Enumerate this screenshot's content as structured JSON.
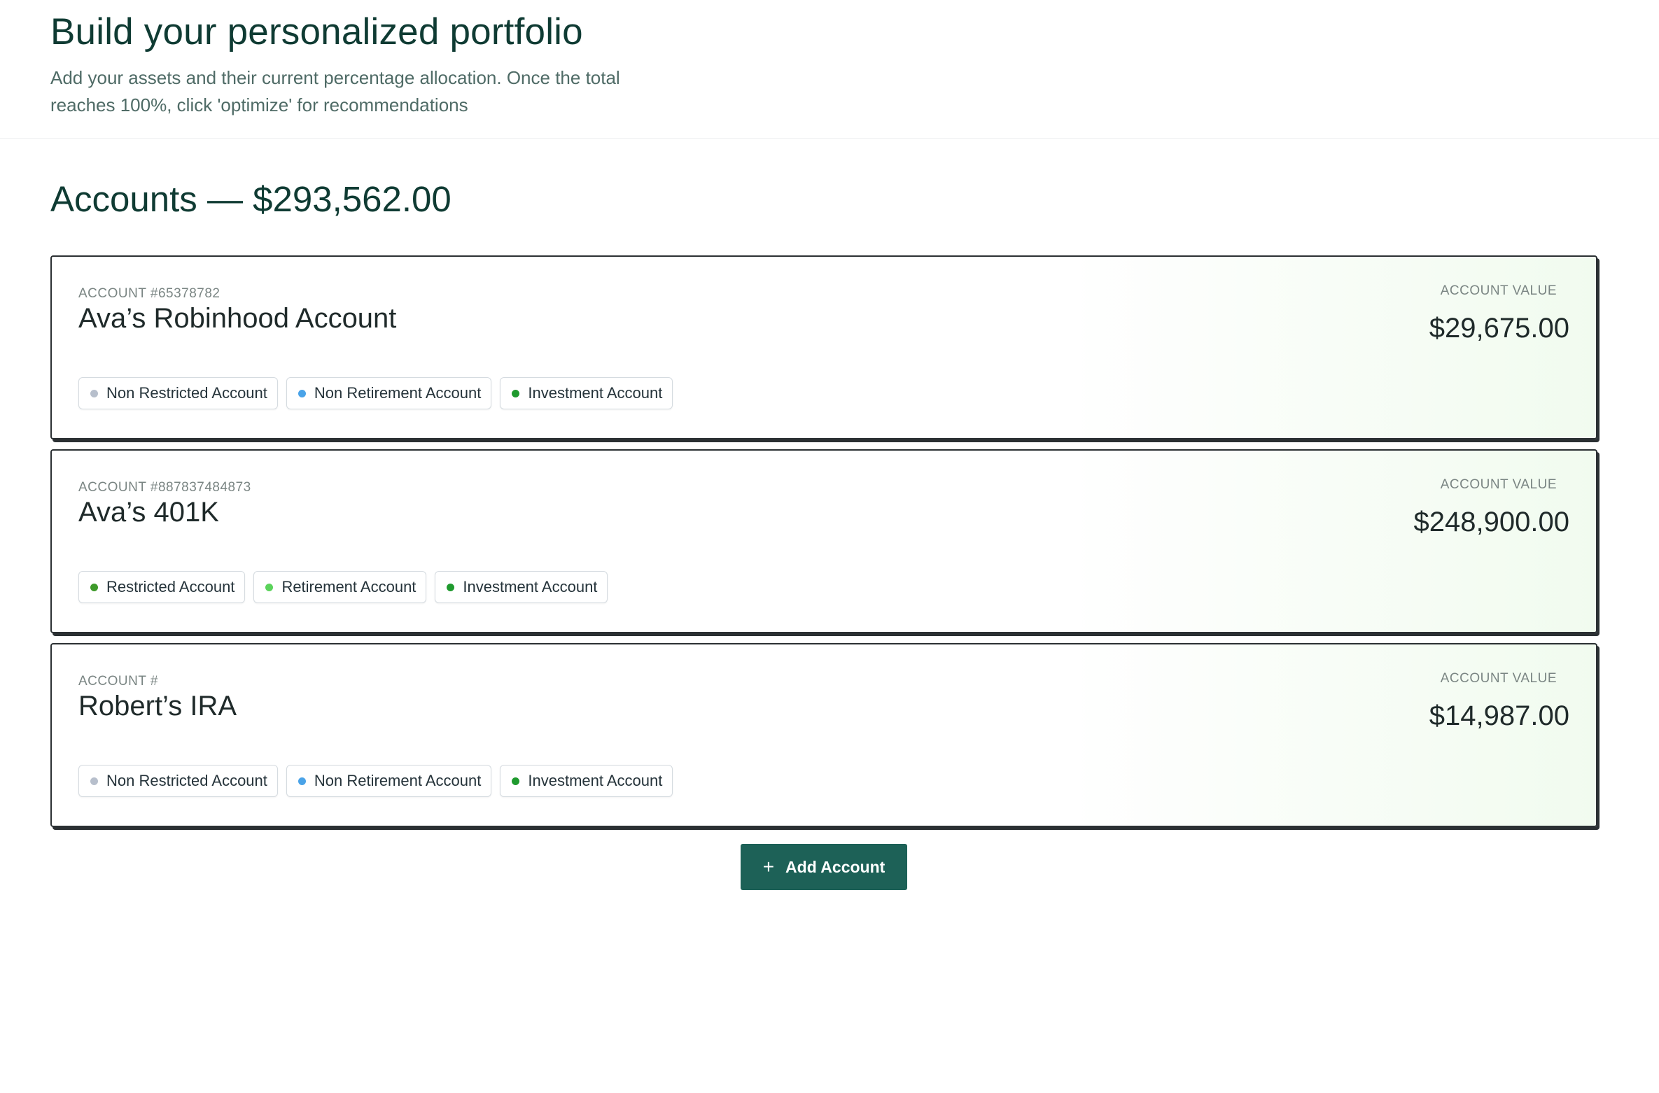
{
  "header": {
    "title": "Build your personalized portfolio",
    "subtitle": "Add your assets and their current percentage allocation. Once the total reaches 100%, click 'optimize' for recommendations"
  },
  "accounts_section": {
    "title": "Accounts — $293,562.00"
  },
  "colors": {
    "brand": "#1d6157",
    "title_text": "#0f3b33",
    "dot_gray": "#b7bfcc",
    "dot_blue": "#4aa3e8",
    "dot_green_dark": "#1f9a2e",
    "dot_green_restricted": "#3e9a2a",
    "dot_green_light": "#5bd35b"
  },
  "accounts": [
    {
      "number_label": "ACCOUNT #65378782",
      "name": "Ava’s Robinhood Account",
      "value_label": "ACCOUNT VALUE",
      "value": "$29,675.00",
      "tags": [
        {
          "label": "Non Restricted Account",
          "dot_color": "#b7bfcc"
        },
        {
          "label": "Non Retirement Account",
          "dot_color": "#4aa3e8"
        },
        {
          "label": "Investment Account",
          "dot_color": "#1f9a2e"
        }
      ]
    },
    {
      "number_label": "ACCOUNT #887837484873",
      "name": "Ava’s 401K",
      "value_label": "ACCOUNT VALUE",
      "value": "$248,900.00",
      "tags": [
        {
          "label": "Restricted Account",
          "dot_color": "#3e9a2a"
        },
        {
          "label": "Retirement Account",
          "dot_color": "#5bd35b"
        },
        {
          "label": "Investment Account",
          "dot_color": "#1f9a2e"
        }
      ]
    },
    {
      "number_label": "ACCOUNT #",
      "name": "Robert’s IRA",
      "value_label": "ACCOUNT VALUE",
      "value": "$14,987.00",
      "tags": [
        {
          "label": "Non Restricted Account",
          "dot_color": "#b7bfcc"
        },
        {
          "label": "Non Retirement Account",
          "dot_color": "#4aa3e8"
        },
        {
          "label": "Investment Account",
          "dot_color": "#1f9a2e"
        }
      ]
    }
  ],
  "add_button": {
    "icon": "plus-icon",
    "label": "Add Account"
  }
}
